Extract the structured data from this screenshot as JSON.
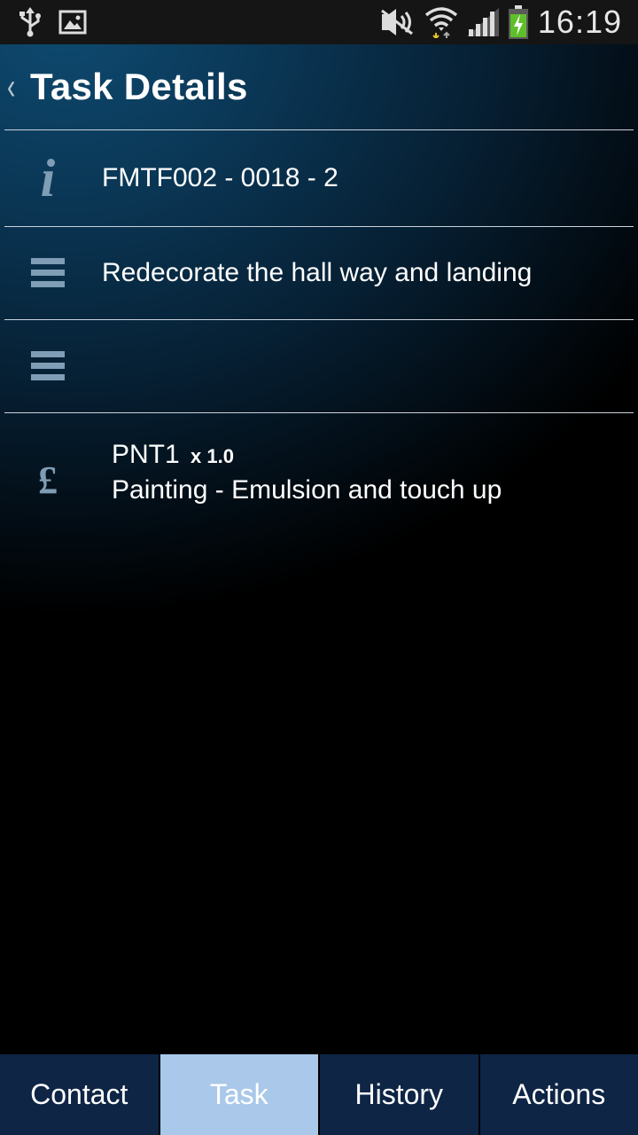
{
  "status_bar": {
    "time": "16:19",
    "icons": [
      "usb-icon",
      "image-icon",
      "mute-icon",
      "wifi-icon",
      "signal-icon",
      "battery-charging-icon"
    ]
  },
  "header": {
    "back_glyph": "‹",
    "title": "Task Details"
  },
  "rows": {
    "reference": "FMTF002 - 0018 - 2",
    "description": "Redecorate the hall way and landing",
    "notes": ""
  },
  "cost_item": {
    "code": "PNT1",
    "quantity": "x 1.0",
    "description": "Painting - Emulsion and touch up",
    "currency_symbol": "£"
  },
  "tabs": [
    {
      "label": "Contact"
    },
    {
      "label": "Task"
    },
    {
      "label": "History"
    },
    {
      "label": "Actions"
    }
  ],
  "colors": {
    "active_tab": "#a9c8ea",
    "inactive_tab": "#0e2545",
    "icon": "#7f9db5"
  }
}
